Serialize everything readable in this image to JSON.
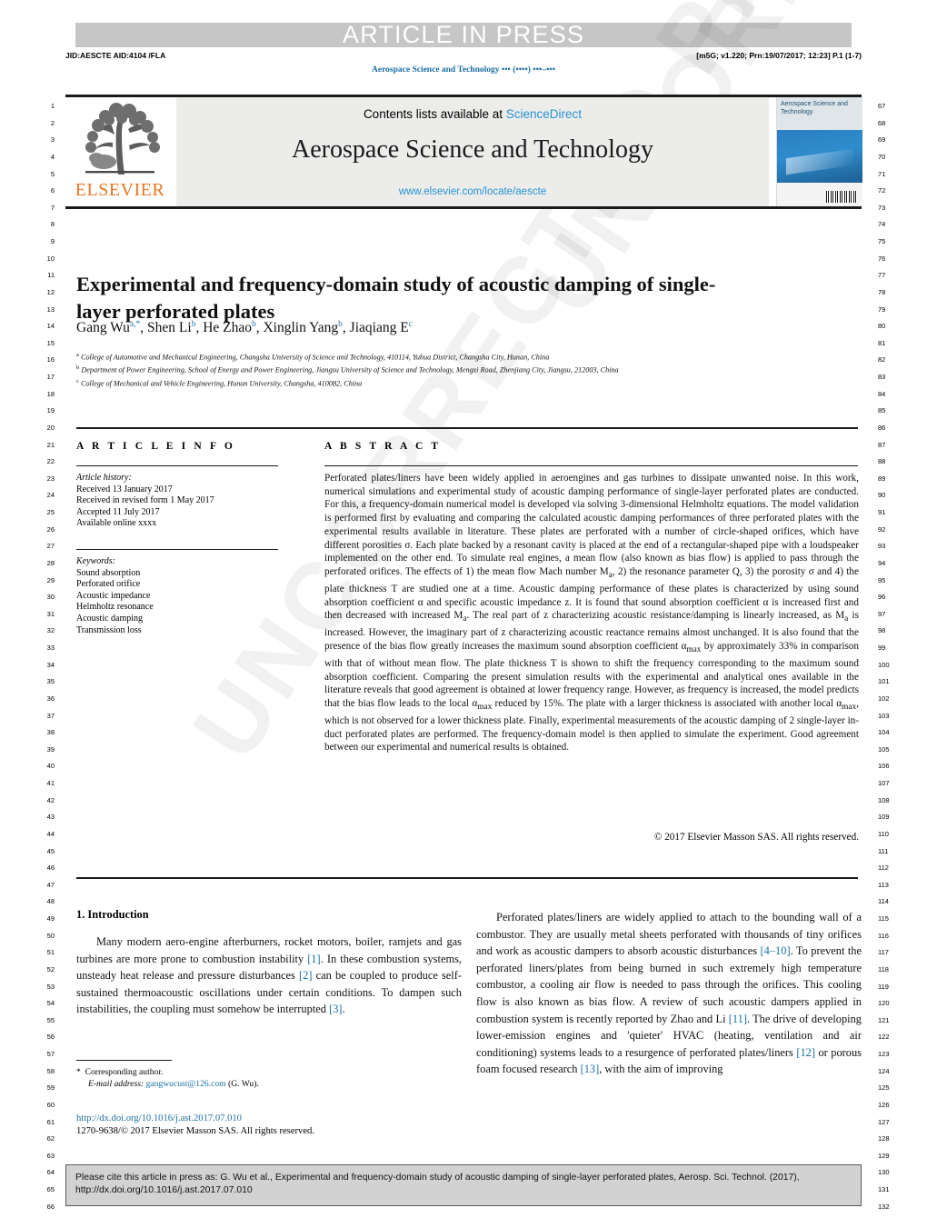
{
  "banner": {
    "text": "ARTICLE IN PRESS"
  },
  "stamp": {
    "jid": "JID:AESCTE   AID:4104 /FLA",
    "proof": "[m5G; v1.220; Prn:19/07/2017; 12:23] P.1 (1-7)",
    "journal_running": "Aerospace Science and Technology ••• (••••) •••–•••"
  },
  "masthead": {
    "contents_prefix": "Contents lists available at ",
    "sciencedirect": "ScienceDirect",
    "journal_title": "Aerospace Science and Technology",
    "journal_url": "www.elsevier.com/locate/aescte",
    "publisher": "ELSEVIER",
    "cover_title": "Aerospace Science and Technology"
  },
  "article": {
    "title": "Experimental and frequency-domain study of acoustic damping of single-layer perforated plates",
    "authors": "Gang Wu a,*, Shen Li b, He Zhao b, Xinglin Yang b, Jiaqiang E c",
    "affiliation_a": "College of Automotive and Mechanical Engineering, Changsha University of Science and Technology, 410114, Yuhua District, Changsha City, Hunan, China",
    "affiliation_b": "Department of Power Engineering, School of Energy and Power Engineering, Jiangsu University of Science and Technology, Mengxi Road, Zhenjiang City, Jiangsu, 212003, China",
    "affiliation_c": "College of Mechanical and Vehicle Engineering, Hunan University, Changsha, 410082, China"
  },
  "info": {
    "heading": "A R T I C L E   I N F O",
    "history_label": "Article history:",
    "history": [
      "Received 13 January 2017",
      "Received in revised form 1 May 2017",
      "Accepted 11 July 2017",
      "Available online xxxx"
    ],
    "keywords_label": "Keywords:",
    "keywords": [
      "Sound absorption",
      "Perforated orifice",
      "Acoustic impedance",
      "Helmholtz resonance",
      "Acoustic damping",
      "Transmission loss"
    ]
  },
  "abstract": {
    "heading": "A B S T R A C T",
    "text": "Perforated plates/liners have been widely applied in aeroengines and gas turbines to dissipate unwanted noise. In this work, numerical simulations and experimental study of acoustic damping performance of single-layer perforated plates are conducted. For this, a frequency-domain numerical model is developed via solving 3-dimensional Helmholtz equations. The model validation is performed first by evaluating and comparing the calculated acoustic damping performances of three perforated plates with the experimental results available in literature. These plates are perforated with a number of circle-shaped orifices, which have different porosities σ. Each plate backed by a resonant cavity is placed at the end of a rectangular-shaped pipe with a loudspeaker implemented on the other end. To simulate real engines, a mean flow (also known as bias flow) is applied to pass through the perforated orifices. The effects of 1) the mean flow Mach number Ma, 2) the resonance parameter Q, 3) the porosity σ and 4) the plate thickness T are studied one at a time. Acoustic damping performance of these plates is characterized by using sound absorption coefficient α and specific acoustic impedance z. It is found that sound absorption coefficient α is increased first and then decreased with increased Ma. The real part of z characterizing acoustic resistance/damping is linearly increased, as Ma is increased. However, the imaginary part of z characterizing acoustic reactance remains almost unchanged. It is also found that the presence of the bias flow greatly increases the maximum sound absorption coefficient αmax by approximately 33% in comparison with that of without mean flow. The plate thickness T is shown to shift the frequency corresponding to the maximum sound absorption coefficient. Comparing the present simulation results with the experimental and analytical ones available in the literature reveals that good agreement is obtained at lower frequency range. However, as frequency is increased, the model predicts that the bias flow leads to the local αmax reduced by 15%. The plate with a larger thickness is associated with another local αmax, which is not observed for a lower thickness plate. Finally, experimental measurements of the acoustic damping of 2 single-layer in-duct perforated plates are performed. The frequency-domain model is then applied to simulate the experiment. Good agreement between our experimental and numerical results is obtained.",
    "copyright": "© 2017 Elsevier Masson SAS. All rights reserved."
  },
  "body": {
    "section_heading": "1. Introduction",
    "left_paragraph": "Many modern aero-engine afterburners, rocket motors, boiler, ramjets and gas turbines are more prone to combustion instability [1]. In these combustion systems, unsteady heat release and pressure disturbances [2] can be coupled to produce self-sustained thermoacoustic oscillations under certain conditions. To dampen such instabilities, the coupling must somehow be interrupted [3].",
    "right_paragraph": "Perforated plates/liners are widely applied to attach to the bounding wall of a combustor. They are usually metal sheets perforated with thousands of tiny orifices and work as acoustic dampers to absorb acoustic disturbances [4–10]. To prevent the perforated liners/plates from being burned in such extremely high temperature combustor, a cooling air flow is needed to pass through the orifices. This cooling flow is also known as bias flow. A review of such acoustic dampers applied in combustion system is recently reported by Zhao and Li [11]. The drive of developing lower-emission engines and 'quieter' HVAC (heating, ventilation and air conditioning) systems leads to a resurgence of perforated plates/liners [12] or porous foam focused research [13], with the aim of improving"
  },
  "footnote": {
    "corresponding": "Corresponding author.",
    "email_label": "E-mail address:",
    "email": "gangwucust@126.com",
    "email_suffix": "(G. Wu)."
  },
  "imprint": {
    "doi": "http://dx.doi.org/10.1016/j.ast.2017.07.010",
    "issn_line": "1270-9638/© 2017 Elsevier Masson SAS. All rights reserved."
  },
  "cite": {
    "text": "Please cite this article in press as: G. Wu et al., Experimental and frequency-domain study of acoustic damping of single-layer perforated plates, Aerosp. Sci. Technol. (2017), http://dx.doi.org/10.1016/j.ast.2017.07.010"
  },
  "watermark": {
    "text": "UNCORRECTED PROOF"
  },
  "line_numbers": {
    "left_start": 1,
    "left_end": 66,
    "right_start": 67,
    "right_end": 132
  },
  "colors": {
    "link": "#1a6fa3",
    "sciencedirect": "#2a93d4",
    "elsevier_orange": "#E87722",
    "banner_gray": "#c6c6c6"
  }
}
